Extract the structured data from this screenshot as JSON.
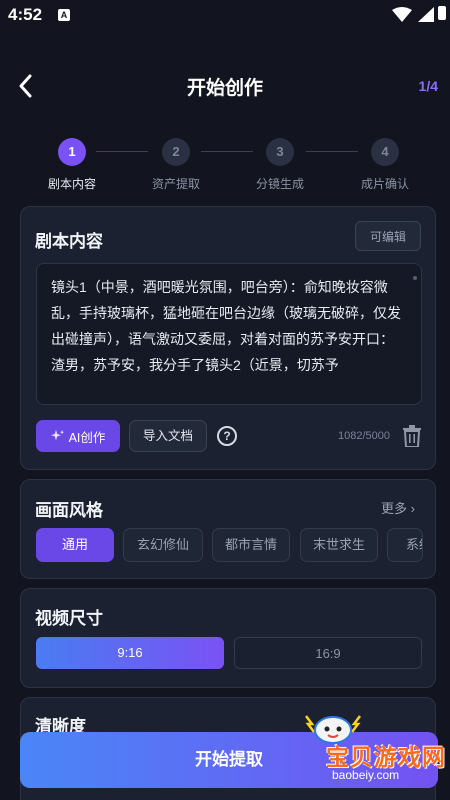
{
  "status_bar": {
    "time": "4:52",
    "app_badge": "A"
  },
  "header": {
    "title": "开始创作",
    "page_indicator": "1/4"
  },
  "steps": [
    {
      "number": "1",
      "label": "剧本内容",
      "active": true
    },
    {
      "number": "2",
      "label": "资产提取",
      "active": false
    },
    {
      "number": "3",
      "label": "分镜生成",
      "active": false
    },
    {
      "number": "4",
      "label": "成片确认",
      "active": false
    }
  ],
  "script_card": {
    "title": "剧本内容",
    "edit_label": "可编辑",
    "content": "镜头1（中景，酒吧暖光氛围，吧台旁）：俞知晚妆容微乱，手持玻璃杯，猛地砸在吧台边缘（玻璃无破碎，仅发出碰撞声），语气激动又委屈，对着对面的苏予安开口：渣男，苏予安，我分手了镜头2（近景，切苏予",
    "ai_label": "AI创作",
    "import_label": "导入文档",
    "help_glyph": "?",
    "char_count": "1082/5000"
  },
  "style_card": {
    "title": "画面风格",
    "more_label": "更多",
    "options": [
      "通用",
      "玄幻修仙",
      "都市言情",
      "末世求生",
      "系统"
    ],
    "selected_index": 0
  },
  "size_card": {
    "title": "视频尺寸",
    "options": [
      "9:16",
      "16:9"
    ],
    "selected_index": 0
  },
  "clarity_card": {
    "title": "清晰度"
  },
  "bottom": {
    "start_label": "开始提取"
  },
  "watermark": {
    "text": "宝贝游戏网",
    "url": "baobeiy.com"
  },
  "colors": {
    "accent": "#7a52f4",
    "background": "#12151f",
    "card": "#1b2131"
  }
}
